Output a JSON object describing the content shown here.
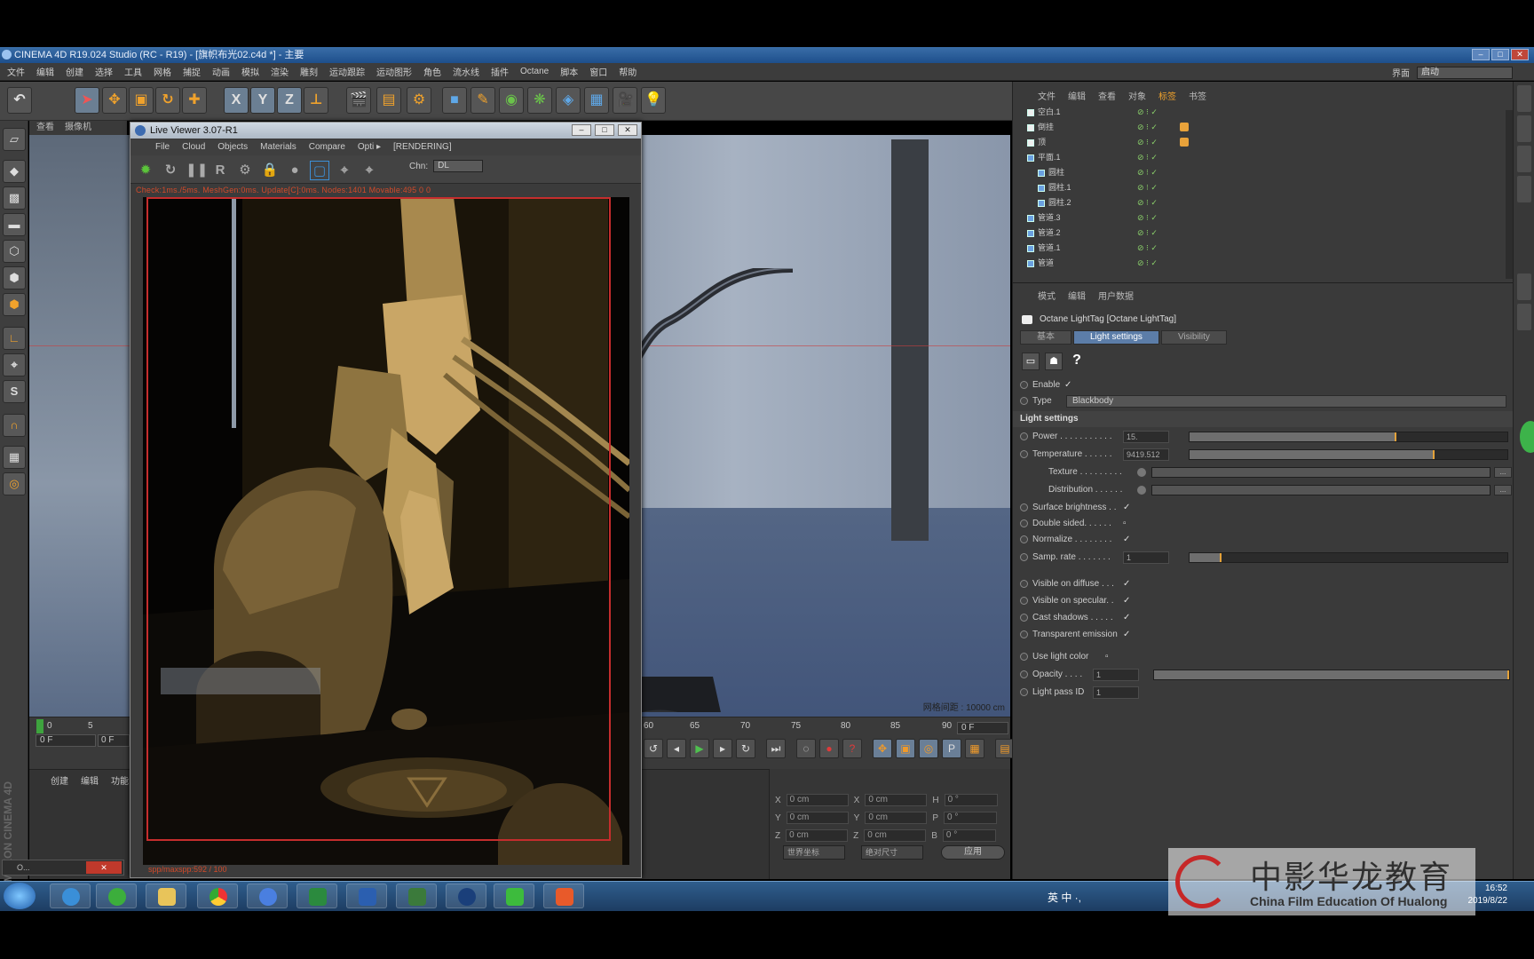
{
  "app": {
    "title": "CINEMA 4D R19.024 Studio (RC - R19) - [旗帜布光02.c4d *] - 主要",
    "layout_label": "界面",
    "layout_value": "启动"
  },
  "menu": [
    "文件",
    "编辑",
    "创建",
    "选择",
    "工具",
    "网格",
    "捕捉",
    "动画",
    "模拟",
    "渲染",
    "雕刻",
    "运动跟踪",
    "运动图形",
    "角色",
    "流水线",
    "插件",
    "Octane",
    "脚本",
    "窗口",
    "帮助"
  ],
  "toolbar": {
    "x_label": "X",
    "y_label": "Y",
    "z_label": "Z"
  },
  "viewport": {
    "tabs": [
      "查看",
      "摄像机"
    ],
    "grid_text": "网格间距 : 10000 cm",
    "axis": "Y"
  },
  "timeline": {
    "ticks_left": [
      "0",
      "5"
    ],
    "ticks_right": [
      "60",
      "65",
      "70",
      "75",
      "80",
      "85",
      "90"
    ],
    "frame_left": "0 F",
    "frame_left2": "0 F",
    "frame_right": "0 F"
  },
  "material_tabs": [
    "创建",
    "编辑",
    "功能"
  ],
  "coords": {
    "rows": [
      {
        "a": "X",
        "av": "0 cm",
        "b": "X",
        "bv": "0 cm",
        "c": "H",
        "cv": "0 °"
      },
      {
        "a": "Y",
        "av": "0 cm",
        "b": "Y",
        "bv": "0 cm",
        "c": "P",
        "cv": "0 °"
      },
      {
        "a": "Z",
        "av": "0 cm",
        "b": "Z",
        "bv": "0 cm",
        "c": "B",
        "cv": "0 °"
      }
    ],
    "sel1": "世界坐标",
    "sel2": "绝对尺寸",
    "apply": "应用"
  },
  "live_viewer": {
    "title": "Live Viewer 3.07-R1",
    "menu": [
      "File",
      "Cloud",
      "Objects",
      "Materials",
      "Compare",
      "Opti ▸",
      "[RENDERING]"
    ],
    "channel_label": "Chn:",
    "channel_value": "DL",
    "stats": "Check:1ms./5ms. MeshGen:0ms. Update[C]:0ms. Nodes:1401 Movable:495  0 0",
    "footer": "spp/maxspp:592 / 100"
  },
  "outliner": {
    "tabs": [
      "文件",
      "编辑",
      "查看",
      "对象",
      "标签",
      "书签"
    ],
    "rows": [
      {
        "name": "空白.1",
        "icon": "w",
        "tag": false
      },
      {
        "name": "倒挂",
        "icon": "w",
        "tag": true
      },
      {
        "name": "顶",
        "icon": "w",
        "tag": true
      },
      {
        "name": "平面.1",
        "icon": "b",
        "tag": false
      },
      {
        "name": "圆柱",
        "icon": "b",
        "tag": false
      },
      {
        "name": "圆柱.1",
        "icon": "b",
        "tag": false
      },
      {
        "name": "圆柱.2",
        "icon": "b",
        "tag": false
      },
      {
        "name": "管道.3",
        "icon": "b",
        "tag": false
      },
      {
        "name": "管道.2",
        "icon": "b",
        "tag": false
      },
      {
        "name": "管道.1",
        "icon": "b",
        "tag": false
      },
      {
        "name": "管道",
        "icon": "b",
        "tag": false
      }
    ]
  },
  "attributes": {
    "tabs_head": [
      "模式",
      "编辑",
      "用户数据"
    ],
    "object": "Octane LightTag [Octane LightTag]",
    "tabs": [
      "基本",
      "Light settings",
      "Visibility"
    ],
    "enable_label": "Enable",
    "type_label": "Type",
    "type_value": "Blackbody",
    "section": "Light settings",
    "power": {
      "label": "Power . . . . . . . . . . .",
      "value": "15.",
      "level": 0.65
    },
    "temperature": {
      "label": "Temperature . . . . . .",
      "value": "9419.512",
      "level": 0.77
    },
    "texture_label": "Texture . . . . . . . . .",
    "distribution_label": "Distribution . . . . . .",
    "checks": [
      {
        "label": "Surface brightness . .",
        "checked": "✓"
      },
      {
        "label": "Double sided. . . . . .",
        "checked": "▫"
      },
      {
        "label": "Normalize . . . . . . . .",
        "checked": "✓"
      }
    ],
    "samp_rate": {
      "label": "Samp. rate . . . . . . .",
      "value": "1",
      "level": 0.1
    },
    "visibility": [
      {
        "label": "Visible on diffuse . . .",
        "checked": "✓"
      },
      {
        "label": "Visible on specular. .",
        "checked": "✓"
      },
      {
        "label": "Cast shadows . . . . .",
        "checked": "✓"
      },
      {
        "label": "Transparent emission",
        "checked": "✓"
      }
    ],
    "use_light_color": {
      "label": "Use light color",
      "checked": "▫"
    },
    "opacity": {
      "label": "Opacity . . . .",
      "value": "1",
      "level": 1.0
    },
    "light_pass": {
      "label": "Light pass ID",
      "value": "1"
    }
  },
  "taskbar": {
    "time": "16:52",
    "date": "2019/8/22",
    "tray_text": "英 中 ·,"
  },
  "watermark": {
    "zh": "中影华龙教育",
    "en": "China Film Education Of Hualong"
  },
  "minimized": {
    "title": "O..."
  },
  "maxon": "MAXON CINEMA 4D"
}
